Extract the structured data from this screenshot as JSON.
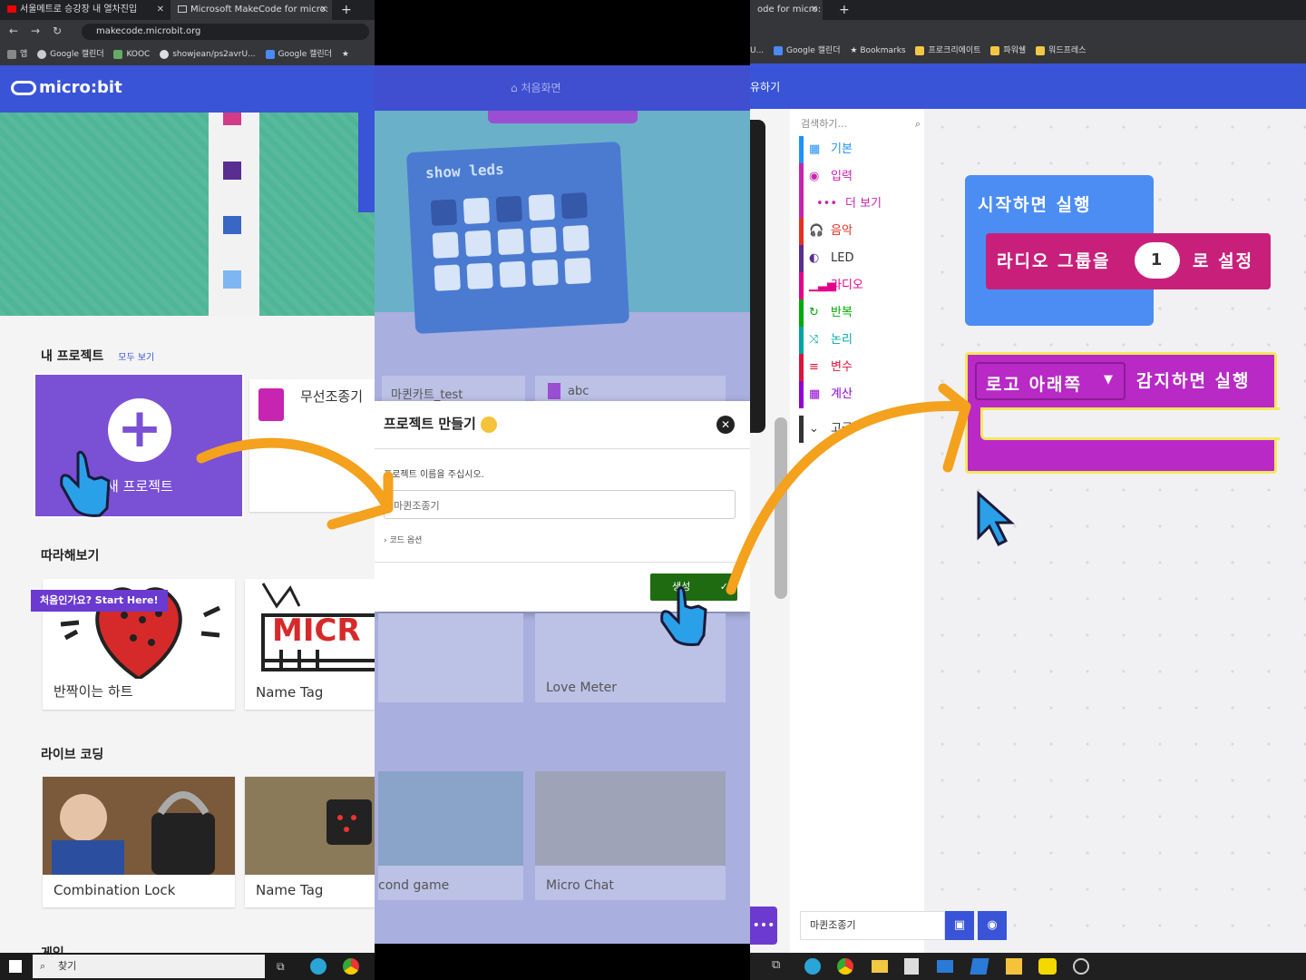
{
  "panel1": {
    "tabs": [
      {
        "label": "서울메트로 승강장 내 열차진입",
        "active": false
      },
      {
        "label": "Microsoft MakeCode for micro:",
        "active": true
      }
    ],
    "new_tab": "+",
    "url": "makecode.microbit.org",
    "bookmarks": [
      "앱",
      "Google 캘린더",
      "KOOC",
      "showjean/ps2avrU...",
      "Google 캘린더"
    ],
    "logo": "micro:bit",
    "my_projects": {
      "title": "내 프로젝트",
      "see_all": "모두 보기",
      "new_project": "새 프로젝트",
      "recent": "무선조종기"
    },
    "tutorials": {
      "title": "따라해보기",
      "badge": "처음인가요? Start Here!",
      "items": [
        "반짝이는 하트",
        "Name Tag"
      ]
    },
    "live_coding": {
      "title": "라이브 코딩",
      "items": [
        "Combination Lock",
        "Name Tag"
      ]
    },
    "games_title": "게임",
    "search": "찾기"
  },
  "panel2": {
    "home": "처음화면",
    "block_label": "show leds",
    "projects": [
      "마퀸카트_test",
      "abc"
    ],
    "modal": {
      "title": "프로젝트 만들기",
      "prompt": "프로젝트 이름을 주십시오.",
      "input_value": "마퀸조종기",
      "options": "코드 옵션",
      "create": "생성"
    },
    "cards": [
      "Love Meter",
      "cond game",
      "Micro Chat"
    ]
  },
  "panel3": {
    "tab": "ode for micro:",
    "new_tab": "+",
    "bookmarks": [
      "U...",
      "Google 캘린더",
      "Bookmarks",
      "프로크리에이트",
      "파워쉘",
      "워드프레스"
    ],
    "header_text": "유하기",
    "search_placeholder": "검색하기...",
    "categories": [
      {
        "label": "기본",
        "color": "#1e90ff",
        "icon": "▦"
      },
      {
        "label": "입력",
        "color": "#c724b1",
        "icon": "◉"
      },
      {
        "label": "더 보기",
        "color": "#c724b1",
        "icon": "•••"
      },
      {
        "label": "음악",
        "color": "#e63022",
        "icon": "🎧"
      },
      {
        "label": "LED",
        "color": "#5c2d91",
        "icon": "◐"
      },
      {
        "label": "라디오",
        "color": "#e3008c",
        "icon": "▁▃▅"
      },
      {
        "label": "반복",
        "color": "#00aa00",
        "icon": "↻"
      },
      {
        "label": "논리",
        "color": "#00a4a6",
        "icon": "⤨"
      },
      {
        "label": "변수",
        "color": "#dc143c",
        "icon": "≡"
      },
      {
        "label": "계산",
        "color": "#9400d3",
        "icon": "▦"
      },
      {
        "label": "고급",
        "color": "#333333",
        "icon": "⌄"
      }
    ],
    "blocks": {
      "on_start": "시작하면 실행",
      "radio_group": "라디오 그룹을",
      "radio_value": "1",
      "radio_suffix": "로 설정",
      "logo_dropdown": "로고 아래쪽",
      "logo_event": "감지하면 실행"
    },
    "project_name": "마퀸조종기"
  },
  "colors": {
    "accent": "#3954d6",
    "purple": "#7a50d4",
    "event": "#b829c6",
    "radio": "#c8207a",
    "start": "#4c8df4",
    "create": "#1e6b12",
    "arrow": "#f4a11d"
  }
}
